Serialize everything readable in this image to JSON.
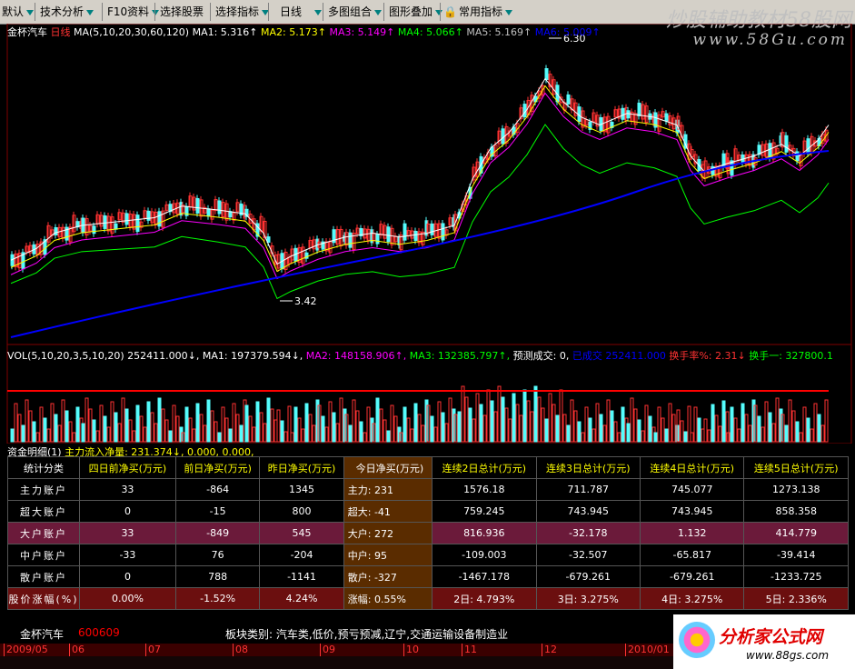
{
  "toolbar": {
    "items": [
      "默认",
      "技术分析",
      "F10资料",
      "选择股票",
      "选择指标",
      "日线",
      "多图组合",
      "图形叠加",
      "常用指标"
    ]
  },
  "watermark": {
    "line1": "炒股辅助教材58股网",
    "line2": "www.58Gu.com"
  },
  "main_chart": {
    "stock": "金杯汽车",
    "period": "日线",
    "ma_label": "MA(5,10,20,30,60,120)",
    "ma1": "MA1: 5.316↑",
    "ma2": "MA2: 5.173↑",
    "ma3": "MA3: 5.149↑",
    "ma4": "MA4: 5.066↑",
    "ma5": "MA5: 5.169↑",
    "ma6": "MA6: 5.009↑",
    "high_label": "6.30",
    "low_label": "3.42"
  },
  "vol_chart": {
    "label": "VOL(5,10,20,3,5,10,20)",
    "value": "252411.000↓,",
    "ma1": "MA1: 197379.594↓,",
    "ma2": "MA2: 148158.906↑,",
    "ma3": "MA3: 132385.797↑,",
    "pred": "预测成交: 0,",
    "zb": "已成交",
    "zbv": "252411.000",
    "hsl": "换手率%: 2.31↓",
    "hs1": "换手一: 327800.1"
  },
  "fund_detail": {
    "title": "资金明细(1)",
    "mainflow": "主力流入净量: 231.374↓, 0.000, 0.000,"
  },
  "table": {
    "headers": [
      "统计分类",
      "四日前净买(万元)",
      "前日净买(万元)",
      "昨日净买(万元)",
      "今日净买(万元)",
      "连续2日总计(万元)",
      "连续3日总计(万元)",
      "连续4日总计(万元)",
      "连续5日总计(万元)"
    ],
    "rows": [
      [
        "主力账户",
        "33",
        "-864",
        "1345",
        "主力: 231",
        "1576.18",
        "711.787",
        "745.077",
        "1273.138"
      ],
      [
        "超大账户",
        "0",
        "-15",
        "800",
        "超大: -41",
        "759.245",
        "743.945",
        "743.945",
        "858.358"
      ],
      [
        "大户账户",
        "33",
        "-849",
        "545",
        "大户: 272",
        "816.936",
        "-32.178",
        "1.132",
        "414.779"
      ],
      [
        "中户账户",
        "-33",
        "76",
        "-204",
        "中户: 95",
        "-109.003",
        "-32.507",
        "-65.817",
        "-39.414"
      ],
      [
        "散户账户",
        "0",
        "788",
        "-1141",
        "散户: -327",
        "-1467.178",
        "-679.261",
        "-679.261",
        "-1233.725"
      ],
      [
        "股价涨幅(%)",
        "0.00%",
        "-1.52%",
        "4.24%",
        "涨幅: 0.55%",
        "2日: 4.793%",
        "3日: 3.275%",
        "4日: 3.275%",
        "5日: 2.336%"
      ]
    ]
  },
  "footer": {
    "stock": "金杯汽车",
    "code": "600609",
    "sector": "板块类别: 汽车类,低价,预亏预减,辽宁,交通运输设备制造业"
  },
  "timeline": [
    "2009/05",
    "06",
    "07",
    "08",
    "09",
    "10",
    "11",
    "12",
    "2010/01"
  ],
  "logo": {
    "text": "分析家公式网",
    "url": "www.88gs.com"
  },
  "colors": {
    "up": "#ff3232",
    "down": "#54fcfc",
    "ma1": "#ffffff",
    "ma2": "#ffff00",
    "ma3": "#ff00ff",
    "ma4": "#00ff00",
    "ma6": "#0000ff"
  }
}
